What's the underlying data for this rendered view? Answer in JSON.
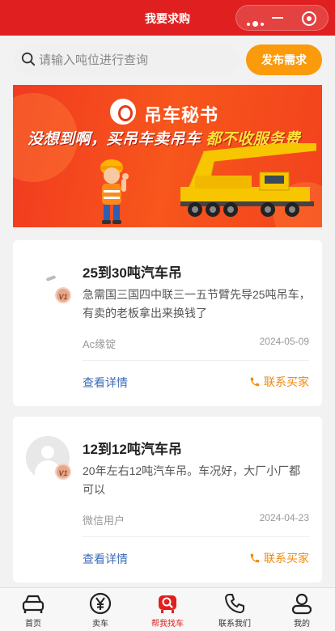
{
  "header": {
    "title": "我要求购"
  },
  "search": {
    "placeholder": "请输入吨位进行查询",
    "value": ""
  },
  "publish_button": "发布需求",
  "banner": {
    "brand": "吊车秘书",
    "slogan_part1": "没想到啊，买吊车卖吊车",
    "slogan_part2": "都不收服务费",
    "slide_count": 6,
    "active_slide": 0
  },
  "posts": [
    {
      "title": "25到30吨汽车吊",
      "description": "急需国三国四中联三一五节臂先导25吨吊车，有卖的老板拿出来换钱了",
      "user": "Ac缘锭",
      "date": "2024-05-09",
      "vip": "V1",
      "detail_label": "查看详情",
      "contact_label": "联系买家"
    },
    {
      "title": "12到12吨汽车吊",
      "description": "20年左右12吨汽车吊。车况好，大厂小厂都可以",
      "user": "微信用户",
      "date": "2024-04-23",
      "vip": "V1",
      "detail_label": "查看详情",
      "contact_label": "联系买家"
    }
  ],
  "tabbar": [
    {
      "label": "首页",
      "icon": "car-icon"
    },
    {
      "label": "卖车",
      "icon": "yen-icon"
    },
    {
      "label": "帮我找车",
      "icon": "search-car-icon",
      "active": true
    },
    {
      "label": "联系我们",
      "icon": "phone-icon"
    },
    {
      "label": "我的",
      "icon": "user-icon"
    }
  ],
  "colors": {
    "brand_red": "#e02020",
    "accent_orange": "#fb9a0a",
    "link_blue": "#3b6bb6",
    "contact_orange": "#f08a0e"
  }
}
